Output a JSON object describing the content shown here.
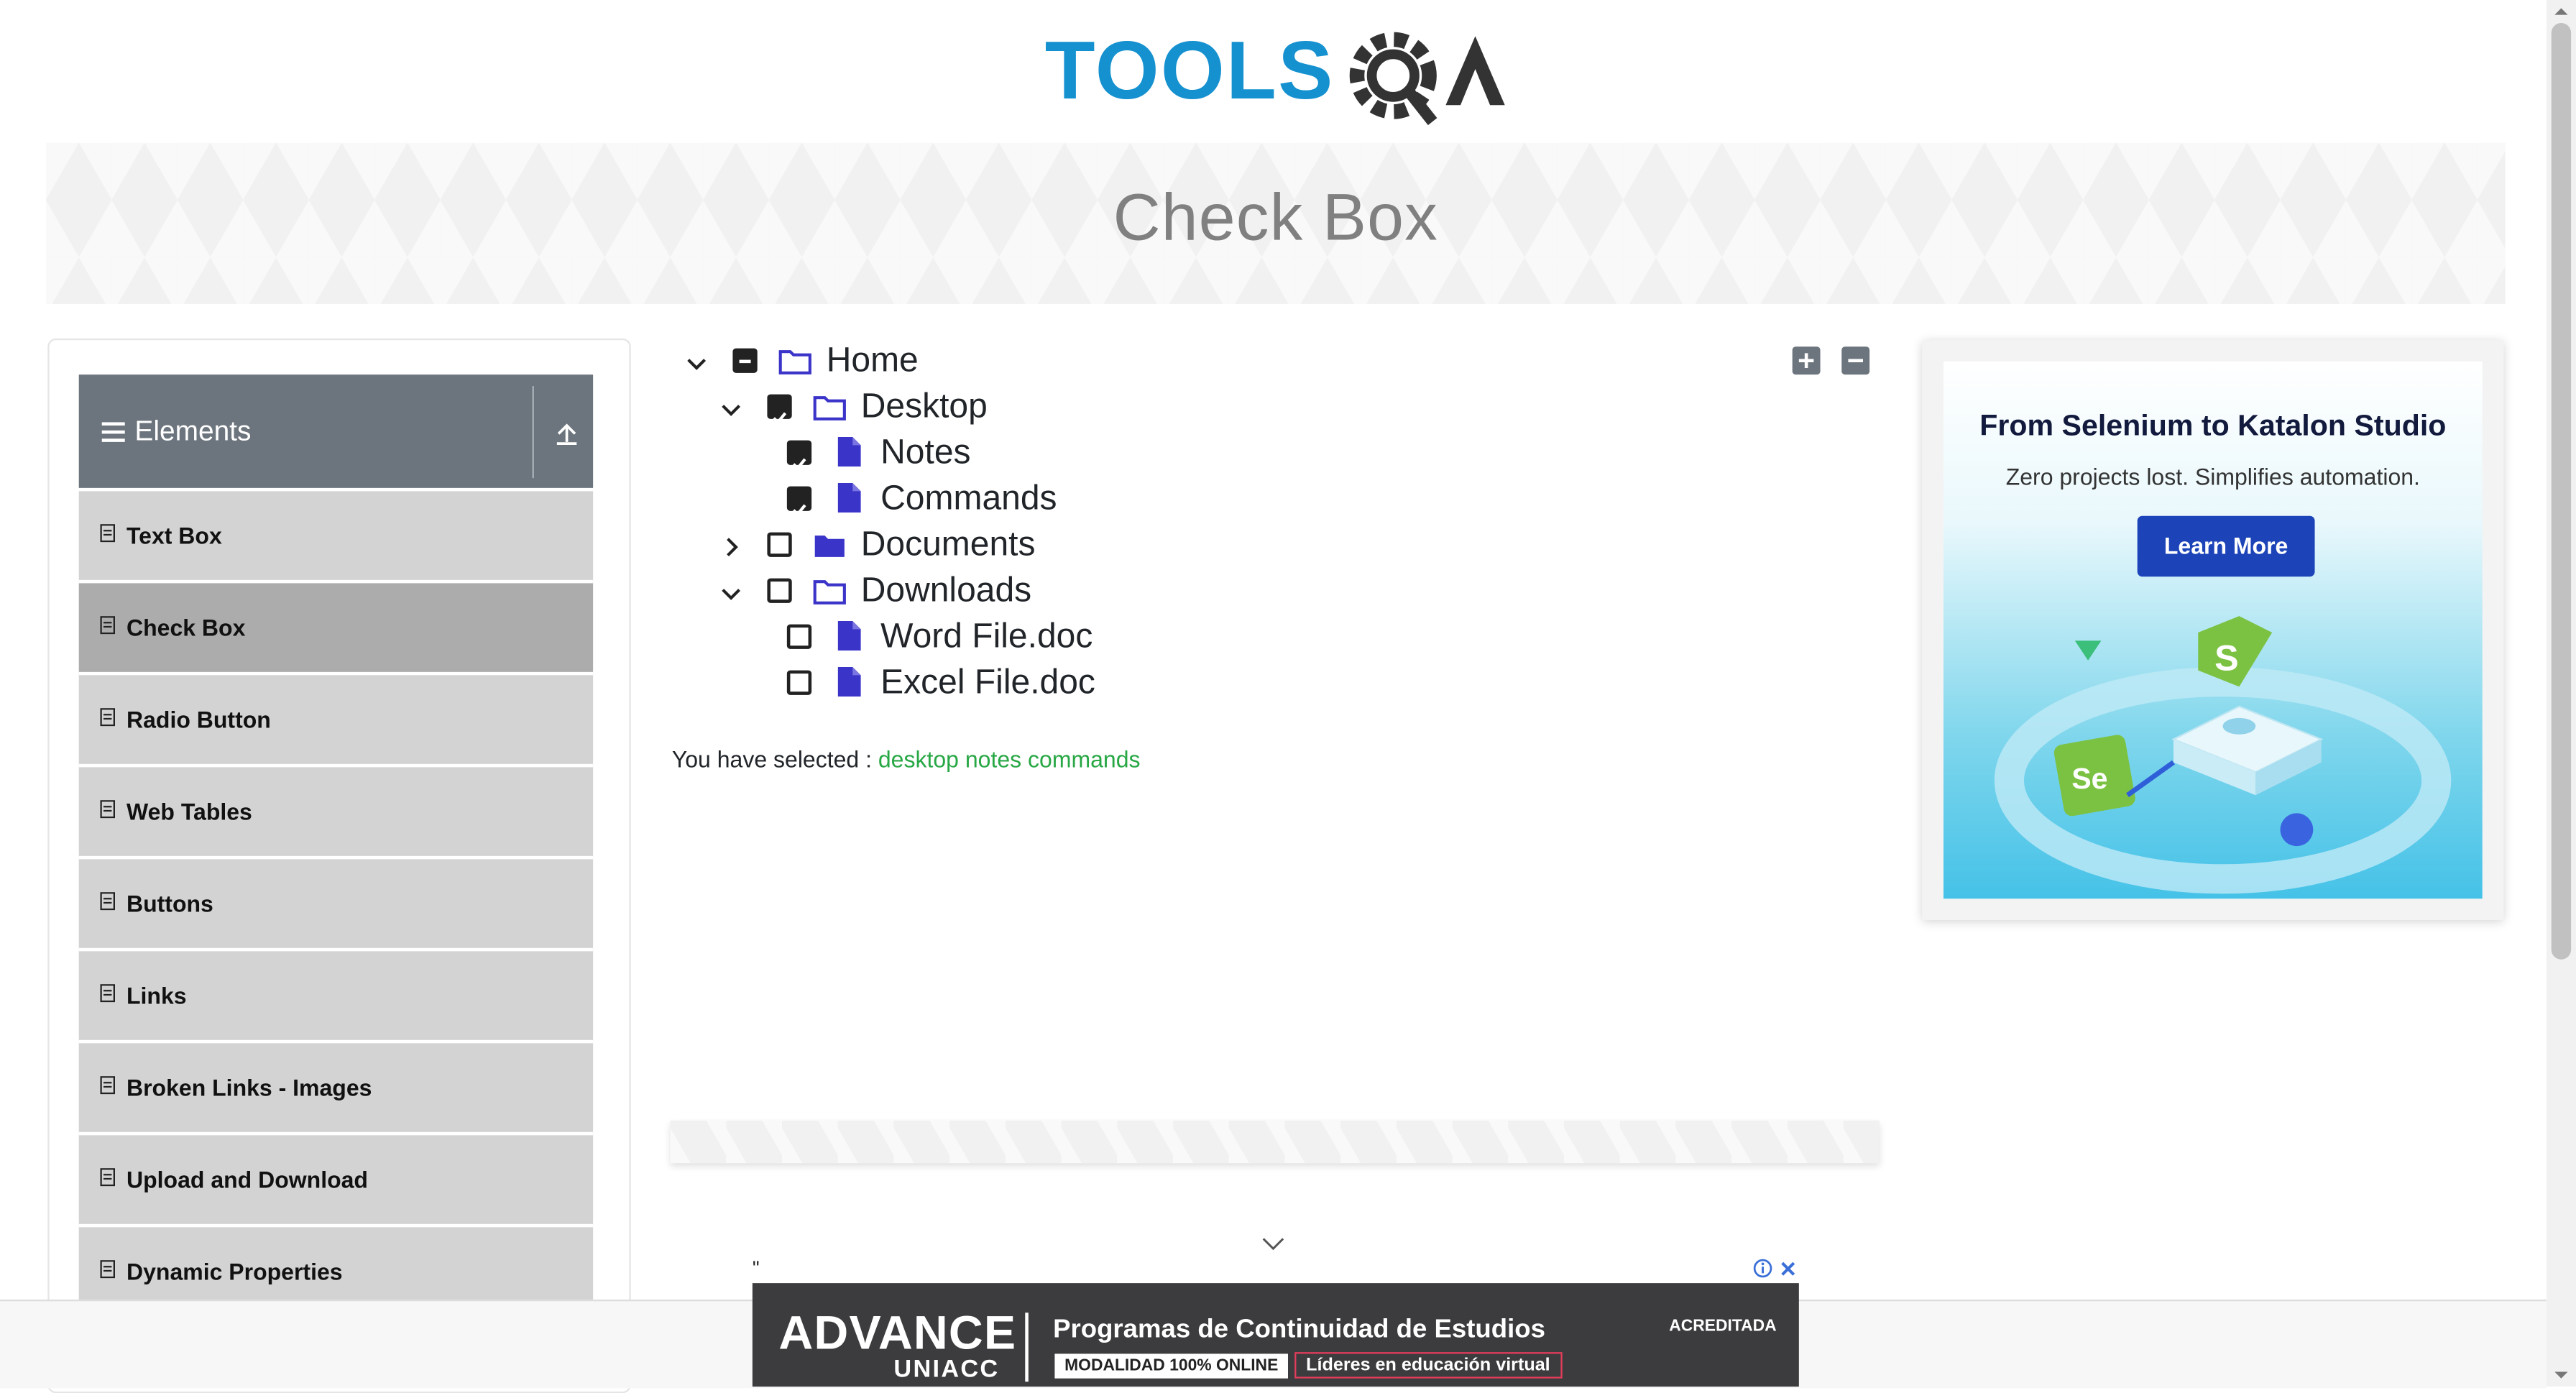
{
  "header": {
    "logo_text": "TOOLSQA",
    "page_title": "Check Box"
  },
  "sidebar": {
    "group_title": "Elements",
    "items": [
      {
        "label": "Text Box"
      },
      {
        "label": "Check Box",
        "active": true
      },
      {
        "label": "Radio Button"
      },
      {
        "label": "Web Tables"
      },
      {
        "label": "Buttons"
      },
      {
        "label": "Links"
      },
      {
        "label": "Broken Links - Images"
      },
      {
        "label": "Upload and Download"
      },
      {
        "label": "Dynamic Properties"
      }
    ]
  },
  "tree": {
    "expand_all_label": "Expand all",
    "collapse_all_label": "Collapse all",
    "nodes": [
      {
        "label": "Home",
        "state": "half",
        "expanded": true
      },
      {
        "label": "Desktop",
        "state": "checked",
        "expanded": true
      },
      {
        "label": "Notes",
        "state": "checked"
      },
      {
        "label": "Commands",
        "state": "checked"
      },
      {
        "label": "Documents",
        "state": "unchecked",
        "expanded": false
      },
      {
        "label": "Downloads",
        "state": "unchecked",
        "expanded": true
      },
      {
        "label": "Word File.doc",
        "state": "unchecked"
      },
      {
        "label": "Excel File.doc",
        "state": "unchecked"
      }
    ]
  },
  "result": {
    "prefix": "You have selected :",
    "items": "desktop notes commands"
  },
  "side_ad": {
    "headline": "From Selenium to Katalon Studio",
    "subline": "Zero projects lost. Simplifies automation.",
    "cta": "Learn More"
  },
  "bottom_ad": {
    "quote": "\"",
    "brand": "ADVANCE",
    "brand_sub": "UNIACC",
    "headline": "Programas de Continuidad de Estudios",
    "tag1": "MODALIDAD 100% ONLINE",
    "tag2": "Líderes en educación virtual",
    "accreditation": "ACREDITADA",
    "close": "✕"
  },
  "colors": {
    "accent_blue": "#1591d0",
    "header_gray": "#6c757d",
    "selected_green": "#28a745",
    "icon_blue": "#3b34c9"
  }
}
